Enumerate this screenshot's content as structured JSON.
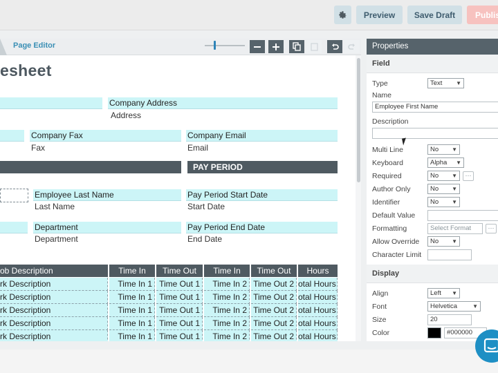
{
  "topbar": {
    "preview_label": "Preview",
    "save_draft_label": "Save Draft",
    "publish_label": "Publis"
  },
  "editor": {
    "tab_label": "Page Editor",
    "zoom_level": 0.2
  },
  "form": {
    "title": "esheet",
    "fields": {
      "company_address": "Company Address",
      "company_address_sub": "Address",
      "company_fax": "Company Fax",
      "company_fax_sub": "Fax",
      "company_email": "Company Email",
      "company_email_sub": "Email",
      "pay_period_bar": "PAY PERIOD",
      "employee_last_name": "Employee Last Name",
      "employee_last_name_sub": "Last Name",
      "pay_period_start": "Pay Period Start Date",
      "pay_period_start_sub": "Start Date",
      "department": "Department",
      "department_sub": "Department",
      "pay_period_end": "Pay Period End Date",
      "pay_period_end_sub": "End Date"
    },
    "table": {
      "headers": [
        "ob Description",
        "Time In",
        "Time Out",
        "Time In",
        "Time Out",
        "Hours"
      ],
      "rows": [
        [
          "rk Description",
          "Time In 1",
          "Time Out 1",
          "Time In 2",
          "Time Out 2",
          "otal Hours"
        ],
        [
          "rk Description",
          "Time In 1",
          "Time Out 1",
          "Time In 2",
          "Time Out 2",
          "otal Hours"
        ],
        [
          "rk Description",
          "Time In 1",
          "Time Out 1",
          "Time In 2",
          "Time Out 2",
          "otal Hours"
        ],
        [
          "rk Description",
          "Time In 1",
          "Time Out 1",
          "Time In 2",
          "Time Out 2",
          "otal Hours"
        ],
        [
          "rk Description",
          "Time In 1",
          "Time Out 1",
          "Time In 2",
          "Time Out 2",
          "otal Hours"
        ]
      ]
    }
  },
  "properties": {
    "header": "Properties",
    "field_section": "Field",
    "type_label": "Type",
    "type_value": "Text",
    "name_label": "Name",
    "name_value": "Employee First Name",
    "description_label": "Description",
    "description_value": "",
    "multiline_label": "Multi Line",
    "multiline_value": "No",
    "keyboard_label": "Keyboard",
    "keyboard_value": "Alpha",
    "required_label": "Required",
    "required_value": "No",
    "author_only_label": "Author Only",
    "author_only_value": "No",
    "identifier_label": "Identifier",
    "identifier_value": "No",
    "default_value_label": "Default Value",
    "default_value_value": "",
    "formatting_label": "Formatting",
    "formatting_placeholder": "Select Format",
    "allow_override_label": "Allow Override",
    "allow_override_value": "No",
    "char_limit_label": "Character Limit",
    "char_limit_value": "",
    "display_section": "Display",
    "align_label": "Align",
    "align_value": "Left",
    "font_label": "Font",
    "font_value": "Helvetica",
    "size_label": "Size",
    "size_value": "20",
    "color_label": "Color",
    "color_value": "#000000"
  },
  "colors": {
    "field_fill": "#ccf5f7",
    "header_dark": "#4f5a61",
    "accent_blue": "#3a8fb5",
    "publish_disabled": "#f7c2bf"
  }
}
